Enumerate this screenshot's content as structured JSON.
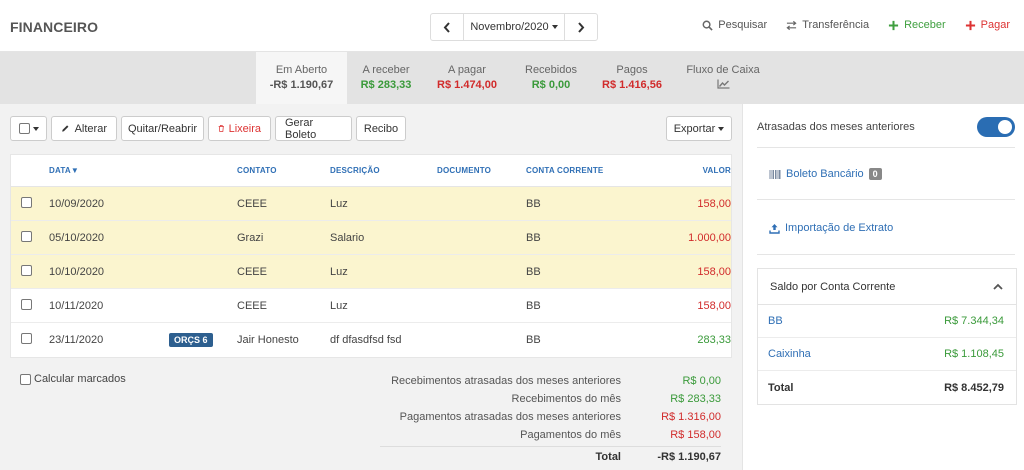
{
  "header": {
    "title": "FINANCEIRO",
    "month": "Novembro/2020",
    "actions": {
      "search": "Pesquisar",
      "transfer": "Transferência",
      "receive": "Receber",
      "pay": "Pagar"
    }
  },
  "tabs": [
    {
      "label": "Em Aberto",
      "value": "-R$ 1.190,67",
      "color": "gray",
      "active": true
    },
    {
      "label": "A receber",
      "value": "R$ 283,33",
      "color": "green"
    },
    {
      "label": "A pagar",
      "value": "R$ 1.474,00",
      "color": "red"
    },
    {
      "label": "Recebidos",
      "value": "R$ 0,00",
      "color": "green"
    },
    {
      "label": "Pagos",
      "value": "R$ 1.416,56",
      "color": "red"
    },
    {
      "label": "Fluxo de Caixa",
      "icon": "chart-line-icon"
    }
  ],
  "toolbar": {
    "edit": "Alterar",
    "settle": "Quitar/Reabrir",
    "trash": "Lixeira",
    "boleto": "Gerar Boleto",
    "receipt": "Recibo",
    "export": "Exportar"
  },
  "table": {
    "headers": {
      "date": "DATA▼",
      "contact": "CONTATO",
      "description": "DESCRIÇÃO",
      "document": "DOCUMENTO",
      "account": "CONTA CORRENTE",
      "value": "VALOR"
    },
    "rows": [
      {
        "date": "10/09/2020",
        "badge": "",
        "contact": "CEEE",
        "description": "Luz",
        "document": "",
        "account": "BB",
        "value": "158,00",
        "overdue": true,
        "type": "red"
      },
      {
        "date": "05/10/2020",
        "badge": "",
        "contact": "Grazi",
        "description": "Salario",
        "document": "",
        "account": "BB",
        "value": "1.000,00",
        "overdue": true,
        "type": "red"
      },
      {
        "date": "10/10/2020",
        "badge": "",
        "contact": "CEEE",
        "description": "Luz",
        "document": "",
        "account": "BB",
        "value": "158,00",
        "overdue": true,
        "type": "red"
      },
      {
        "date": "10/11/2020",
        "badge": "",
        "contact": "CEEE",
        "description": "Luz",
        "document": "",
        "account": "BB",
        "value": "158,00",
        "overdue": false,
        "type": "red"
      },
      {
        "date": "23/11/2020",
        "badge": "ORÇS 6",
        "contact": "Jair Honesto",
        "description": "df dfasdfsd fsd",
        "document": "",
        "account": "BB",
        "value": "283,33",
        "overdue": false,
        "type": "green"
      }
    ]
  },
  "footer": {
    "calc_marked": "Calcular marcados",
    "summary": [
      {
        "label": "Recebimentos atrasadas dos meses anteriores",
        "value": "R$ 0,00",
        "type": "green"
      },
      {
        "label": "Recebimentos do mês",
        "value": "R$ 283,33",
        "type": "green"
      },
      {
        "label": "Pagamentos atrasadas dos meses anteriores",
        "value": "R$ 1.316,00",
        "type": "red"
      },
      {
        "label": "Pagamentos do mês",
        "value": "R$ 158,00",
        "type": "red"
      }
    ],
    "total_label": "Total",
    "total_value": "-R$ 1.190,67"
  },
  "sidebar": {
    "overdue_toggle": "Atrasadas dos meses anteriores",
    "boleto": "Boleto Bancário",
    "boleto_count": "0",
    "import": "Importação de Extrato",
    "saldo_title": "Saldo por Conta Corrente",
    "accounts": [
      {
        "name": "BB",
        "value": "R$ 7.344,34"
      },
      {
        "name": "Caixinha",
        "value": "R$ 1.108,45"
      }
    ],
    "total_label": "Total",
    "total_value": "R$ 8.452,79"
  },
  "colors": {
    "accent": "#2f6fb5",
    "green": "#3a9a3a",
    "red": "#d12b2b",
    "overdue_row": "#fbf5cf"
  }
}
